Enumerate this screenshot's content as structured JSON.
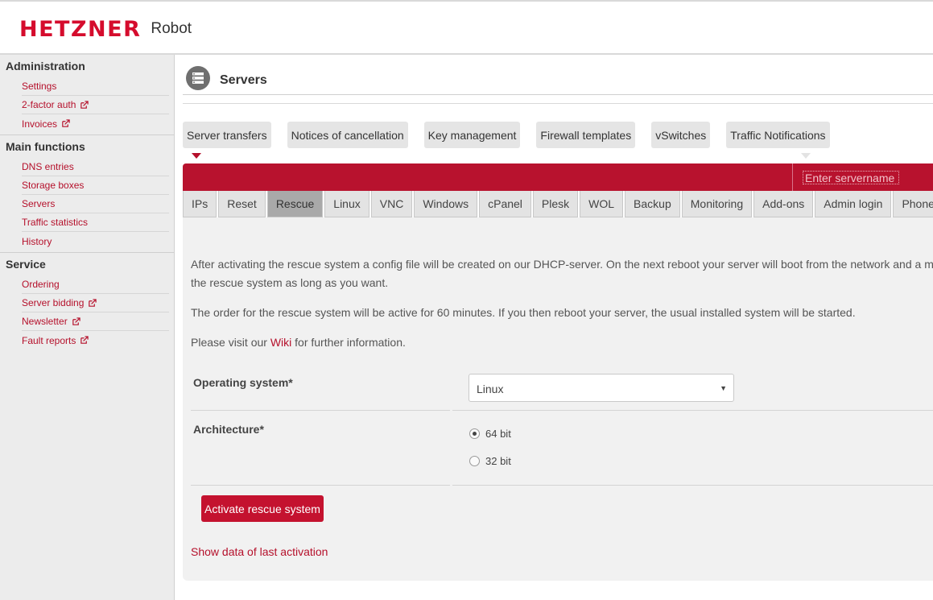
{
  "header": {
    "logo_text": "HETZNER",
    "logo_suffix": "Robot"
  },
  "sidebar": {
    "sections": [
      {
        "title": "Administration",
        "items": [
          {
            "label": "Settings",
            "external": false
          },
          {
            "label": "2-factor auth",
            "external": true
          },
          {
            "label": "Invoices",
            "external": true
          }
        ]
      },
      {
        "title": "Main functions",
        "items": [
          {
            "label": "DNS entries",
            "external": false
          },
          {
            "label": "Storage boxes",
            "external": false
          },
          {
            "label": "Servers",
            "external": false
          },
          {
            "label": "Traffic statistics",
            "external": false
          },
          {
            "label": "History",
            "external": false
          }
        ]
      },
      {
        "title": "Service",
        "items": [
          {
            "label": "Ordering",
            "external": false
          },
          {
            "label": "Server bidding",
            "external": true
          },
          {
            "label": "Newsletter",
            "external": true
          },
          {
            "label": "Fault reports",
            "external": true
          }
        ]
      }
    ]
  },
  "page": {
    "title": "Servers"
  },
  "subnav": [
    "Server transfers",
    "Notices of cancellation",
    "Key management",
    "Firewall templates",
    "vSwitches",
    "Traffic Notifications"
  ],
  "search": {
    "placeholder": "Enter servername"
  },
  "tabs": [
    "IPs",
    "Reset",
    "Rescue",
    "Linux",
    "VNC",
    "Windows",
    "cPanel",
    "Plesk",
    "WOL",
    "Backup",
    "Monitoring",
    "Add-ons",
    "Admin login",
    "Phone"
  ],
  "active_tab": "Rescue",
  "rescue": {
    "intro_line1": "After activating the rescue system a config file will be created on our DHCP-server. On the next reboot your server will boot from the network and a m",
    "intro_line2": "the rescue system as long as you want.",
    "order_text": "The order for the rescue system will be active for 60 minutes. If you then reboot your server, the usual installed system will be started.",
    "visit_prefix": "Please visit our ",
    "visit_link": "Wiki",
    "visit_suffix": " for further information.",
    "os_label": "Operating system*",
    "os_value": "Linux",
    "arch_label": "Architecture*",
    "arch_options": [
      "64 bit",
      "32 bit"
    ],
    "arch_selected": "64 bit",
    "activate_label": "Activate rescue system",
    "show_last_label": "Show data of last activation"
  },
  "colors": {
    "brand_red": "#d50c2d",
    "link_red": "#b5102b",
    "bar_red": "#b8122e"
  }
}
